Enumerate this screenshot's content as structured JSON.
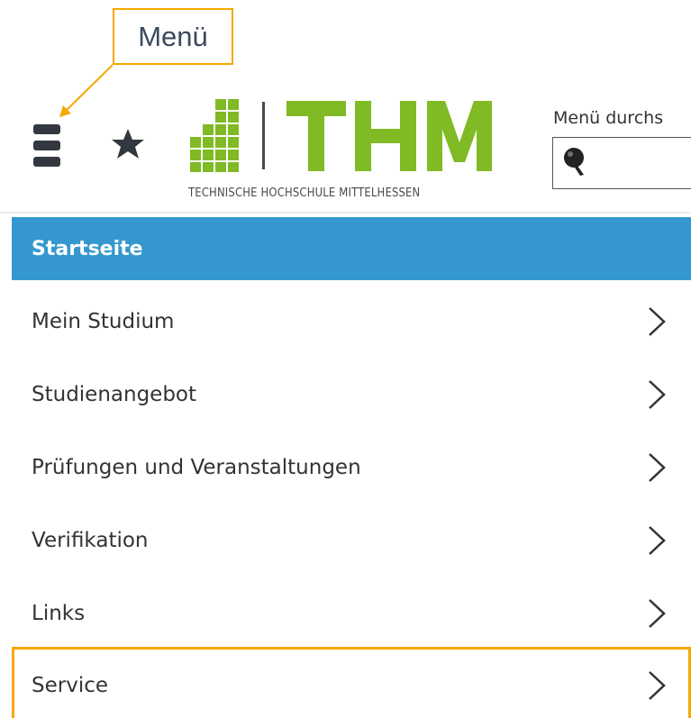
{
  "annotation": {
    "callout_text": "Menü",
    "color": "#f5a800"
  },
  "header": {
    "menu_icon": "hamburger-icon",
    "favorite_icon": "star-icon",
    "logo": {
      "text": "THM",
      "subtitle": "TECHNISCHE HOCHSCHULE MITTELHESSEN",
      "color": "#80ba24"
    },
    "search": {
      "label": "Menü durchs",
      "value": "",
      "icon": "search-icon"
    }
  },
  "nav": {
    "title": "Startseite",
    "title_bg": "#3498cf",
    "items": [
      {
        "label": "Mein Studium",
        "icon": "chevron-right-icon"
      },
      {
        "label": "Studienangebot",
        "icon": "chevron-right-icon"
      },
      {
        "label": "Prüfungen und Veranstaltungen",
        "icon": "chevron-right-icon"
      },
      {
        "label": "Verifikation",
        "icon": "chevron-right-icon"
      },
      {
        "label": "Links",
        "icon": "chevron-right-icon"
      },
      {
        "label": "Service",
        "icon": "chevron-right-icon",
        "highlighted": true
      }
    ]
  }
}
